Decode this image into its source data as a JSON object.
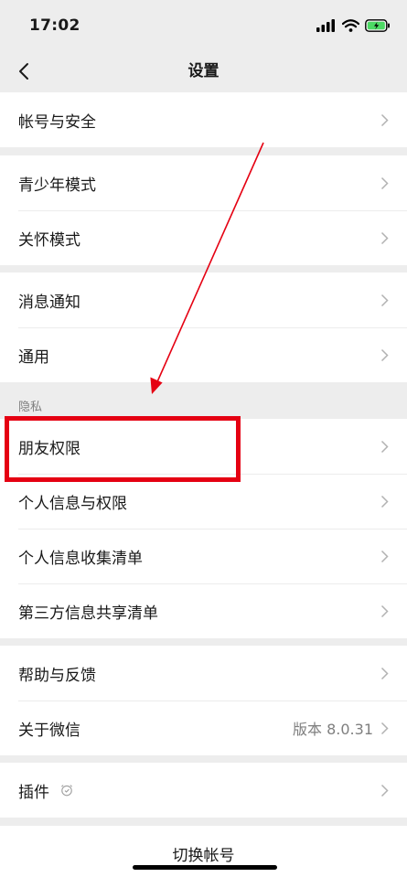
{
  "status_bar": {
    "time": "17:02"
  },
  "nav": {
    "title": "设置"
  },
  "groups": {
    "account": [
      {
        "label": "帐号与安全"
      }
    ],
    "modes": [
      {
        "label": "青少年模式"
      },
      {
        "label": "关怀模式"
      }
    ],
    "general": [
      {
        "label": "消息通知"
      },
      {
        "label": "通用"
      }
    ],
    "privacy_header": "隐私",
    "privacy": [
      {
        "label": "朋友权限"
      },
      {
        "label": "个人信息与权限"
      },
      {
        "label": "个人信息收集清单"
      },
      {
        "label": "第三方信息共享清单"
      }
    ],
    "help": [
      {
        "label": "帮助与反馈"
      },
      {
        "label": "关于微信",
        "value": "版本 8.0.31"
      }
    ],
    "plugins": [
      {
        "label": "插件"
      }
    ]
  },
  "footer": {
    "switch_account": "切换帐号"
  },
  "icons": {
    "back": "chevron-left-icon",
    "row": "chevron-right-icon",
    "plugin": "clock-icon",
    "signal": "signal-bars-icon",
    "wifi": "wifi-icon",
    "battery": "battery-charging-icon"
  },
  "colors": {
    "background": "#ededed",
    "cell": "#ffffff",
    "annotation": "#e50012",
    "battery": "#4cd964"
  }
}
